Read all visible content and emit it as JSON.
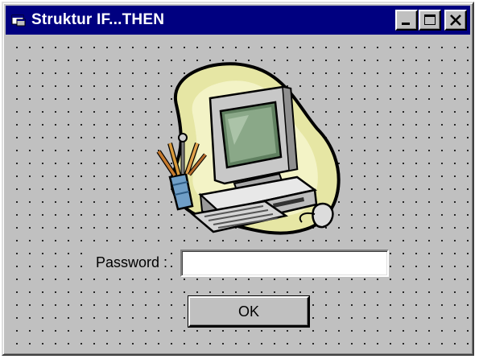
{
  "window": {
    "title": "Struktur IF...THEN",
    "icon": "form-icon",
    "buttons": [
      "minimize-icon",
      "maximize-icon",
      "close-icon"
    ]
  },
  "form": {
    "picture": "computer-clipart",
    "password_label": "Password :",
    "password_value": "",
    "ok_label": "OK"
  },
  "colors": {
    "face": "#c0c0c0",
    "title_bar": "#000080",
    "title_text": "#ffffff"
  }
}
